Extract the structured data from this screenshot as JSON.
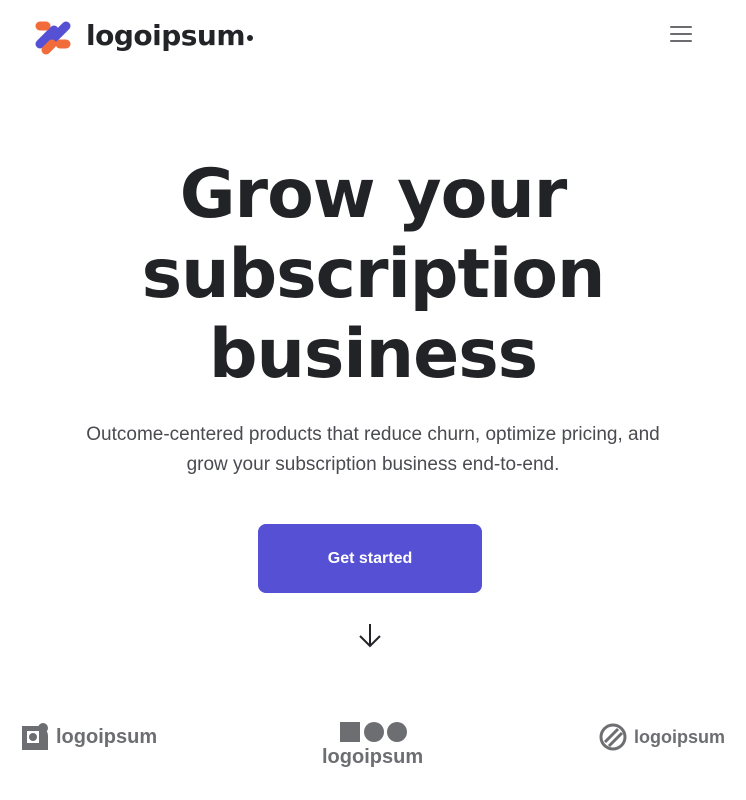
{
  "header": {
    "brand_name": "logoipsum",
    "menu_icon": "hamburger-menu-icon",
    "brand_colors": [
      "#f26b3a",
      "#5550d4"
    ]
  },
  "hero": {
    "title_lines": [
      "Grow your",
      "subscription",
      "business"
    ],
    "subtitle_lines": [
      "Outcome-centered products that reduce churn, optimize pricing, and",
      "grow your subscription business end-to-end."
    ],
    "cta_label": "Get started",
    "scroll_icon": "arrow-down-icon",
    "accent_color": "#5550d4"
  },
  "partner_logos": [
    {
      "name": "logoipsum",
      "icon": "rounded-square-logo-icon"
    },
    {
      "name": "logoipsum",
      "icon": "square-circles-logo-icon"
    },
    {
      "name": "logoipsum",
      "icon": "striped-circle-logo-icon"
    }
  ]
}
